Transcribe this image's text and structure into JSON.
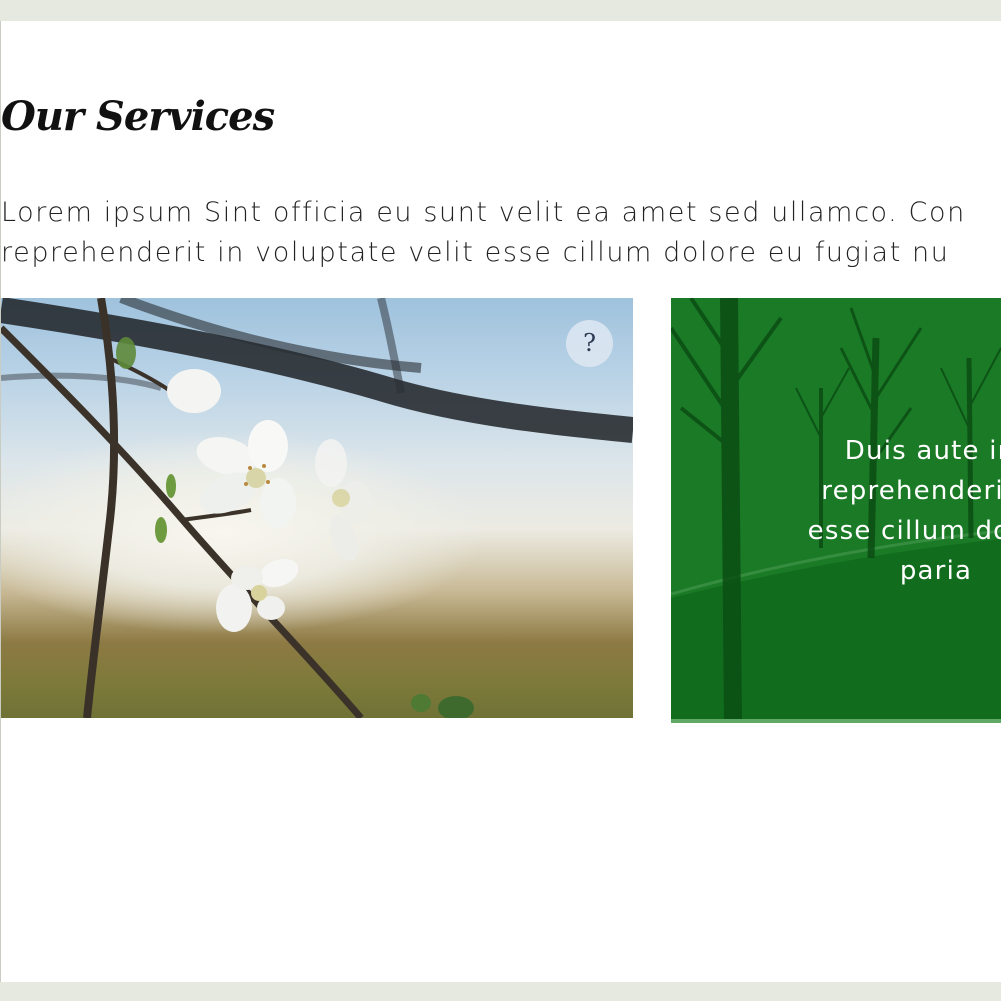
{
  "services": {
    "heading": "Our Services",
    "intro_lines": [
      "Lorem ipsum Sint officia eu sunt velit ea amet sed ullamco. Con",
      "reprehenderit in voluptate velit esse cillum dolore eu fugiat nu"
    ],
    "photo_card": {
      "help_label": "?",
      "help_icon": "question-icon"
    },
    "green_card": {
      "lines": [
        "Duis aute iru",
        "reprehenderit in",
        "esse cillum dolore",
        "paria"
      ],
      "overlay_color": "#1a7a26"
    }
  }
}
